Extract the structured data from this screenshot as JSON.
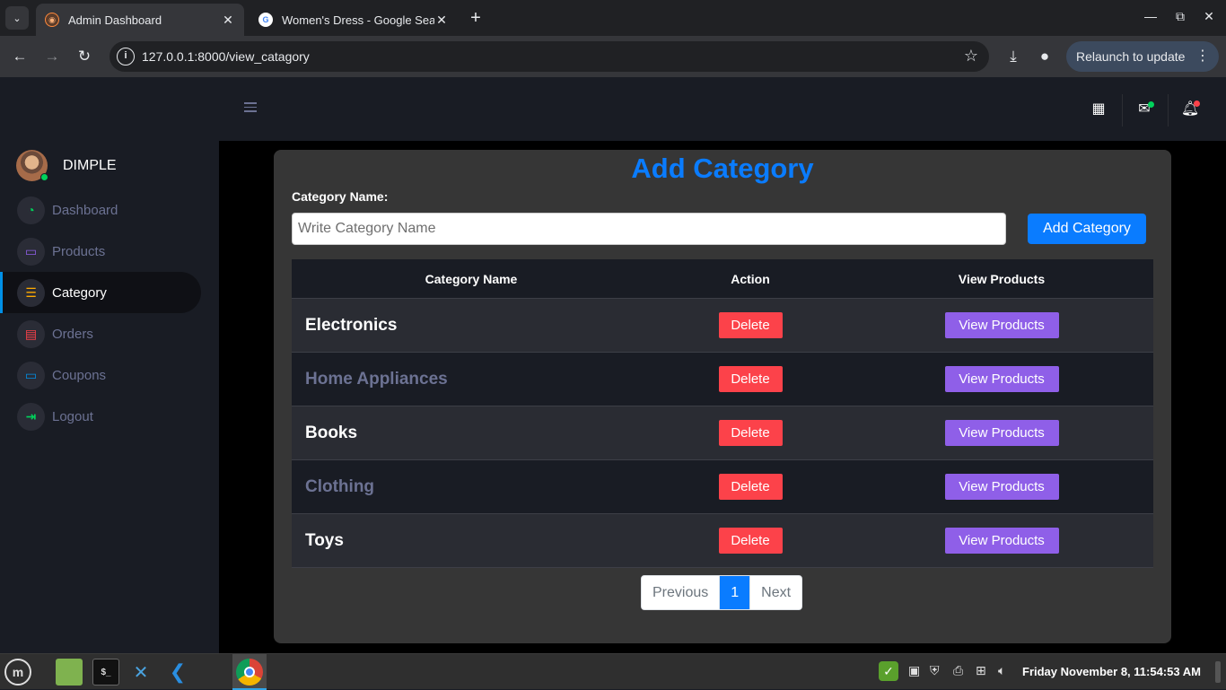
{
  "browser": {
    "tabs": [
      {
        "title": "Admin Dashboard",
        "active": true
      },
      {
        "title": "Women's Dress - Google Sea",
        "active": false
      }
    ],
    "url": "127.0.0.1:8000/view_catagory",
    "relaunch_label": "Relaunch to update"
  },
  "sidebar": {
    "user_name": "DIMPLE",
    "items": [
      {
        "label": "Dashboard",
        "icon": "speedometer-icon",
        "color": "#00d25b"
      },
      {
        "label": "Products",
        "icon": "laptop-icon",
        "color": "#8f5fe8"
      },
      {
        "label": "Category",
        "icon": "list-icon",
        "color": "#ffab00",
        "active": true
      },
      {
        "label": "Orders",
        "icon": "table-icon",
        "color": "#fc424a"
      },
      {
        "label": "Coupons",
        "icon": "monitor-icon",
        "color": "#0090e7"
      },
      {
        "label": "Logout",
        "icon": "logout-icon",
        "color": "#00d25b"
      }
    ]
  },
  "main": {
    "title": "Add Category",
    "field_label": "Category Name:",
    "input_placeholder": "Write Category Name",
    "add_button": "Add Category",
    "table": {
      "headers": [
        "Category Name",
        "Action",
        "View Products"
      ],
      "rows": [
        {
          "name": "Electronics",
          "action": "Delete",
          "view": "View Products"
        },
        {
          "name": "Home Appliances",
          "action": "Delete",
          "view": "View Products"
        },
        {
          "name": "Books",
          "action": "Delete",
          "view": "View Products"
        },
        {
          "name": "Clothing",
          "action": "Delete",
          "view": "View Products"
        },
        {
          "name": "Toys",
          "action": "Delete",
          "view": "View Products"
        }
      ]
    },
    "pagination": {
      "previous": "Previous",
      "current": "1",
      "next": "Next"
    }
  },
  "taskbar": {
    "clock": "Friday November  8, 11:54:53 AM"
  },
  "colors": {
    "accent": "#0a7cff",
    "danger": "#fc424a",
    "purple": "#8f5fe8"
  }
}
